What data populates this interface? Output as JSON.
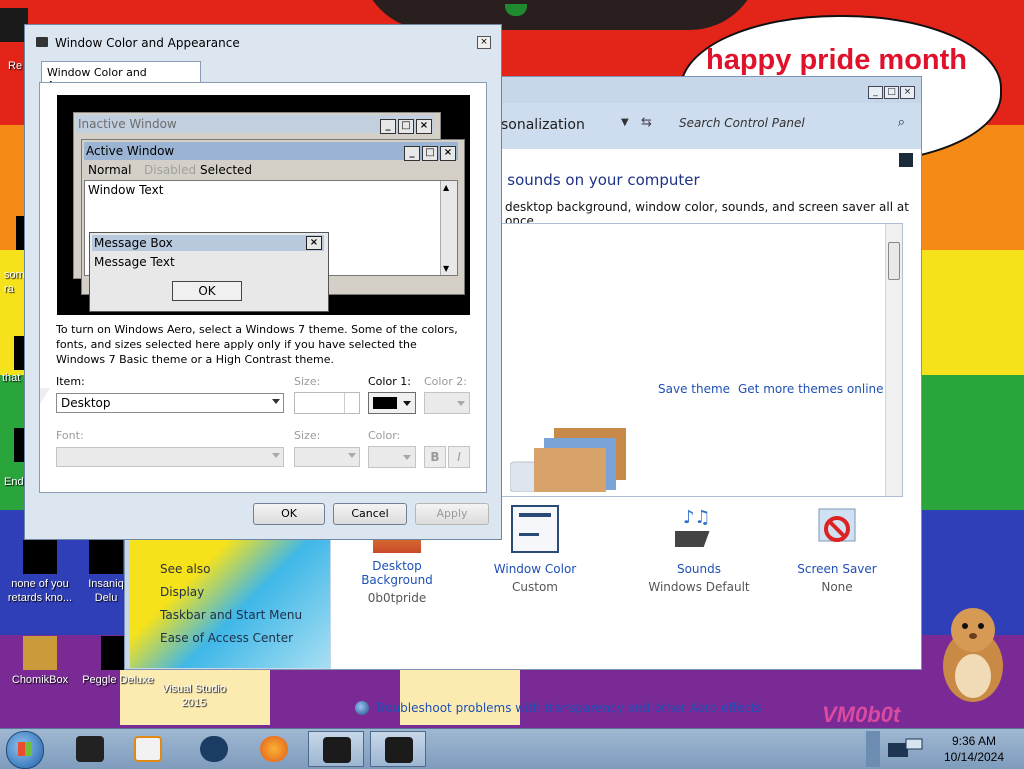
{
  "desktop": {
    "speech_text": "happy pride month",
    "watermark": "VM0b0t",
    "icons": [
      {
        "label": "none of you retards kno..."
      },
      {
        "label": "Insaniq Delu"
      },
      {
        "label": "ChomikBox"
      },
      {
        "label": "Peggle Deluxe"
      },
      {
        "label": "Visual Studio 2015"
      }
    ],
    "partial_labels": [
      "Re",
      "som ra",
      "that",
      "End"
    ]
  },
  "taskbar": {
    "time": "9:36 AM",
    "date": "10/14/2024"
  },
  "personalization": {
    "breadcrumb": "sonalization",
    "search_placeholder": "Search Control Panel",
    "heading": "d sounds on your computer",
    "subtitle": "desktop background, window color, sounds, and screen saver all at once.",
    "save_theme": "Save theme",
    "more_themes": "Get more themes online",
    "see_also": "See also",
    "links": [
      "Display",
      "Taskbar and Start Menu",
      "Ease of Access Center"
    ],
    "items": [
      {
        "label": "Desktop Background",
        "value": "0b0tpride"
      },
      {
        "label": "Window Color",
        "value": "Custom"
      },
      {
        "label": "Sounds",
        "value": "Windows Default"
      },
      {
        "label": "Screen Saver",
        "value": "None"
      }
    ],
    "troubleshoot": "Troubleshoot problems with transparency and other Aero effects"
  },
  "dialog": {
    "title": "Window Color and Appearance",
    "tab_label": "Window Color and Appearance",
    "preview": {
      "inactive_title": "Inactive Window",
      "active_title": "Active Window",
      "menu_normal": "Normal",
      "menu_disabled": "Disabled",
      "menu_selected": "Selected",
      "window_text": "Window Text",
      "msgbox_title": "Message Box",
      "msgbox_text": "Message Text",
      "msgbox_ok": "OK"
    },
    "aero_note": "To turn on Windows Aero, select a Windows 7 theme.  Some of the colors, fonts, and sizes selected here apply only if you have selected the Windows 7 Basic theme or a High Contrast theme.",
    "item_label": "Item:",
    "item_value": "Desktop",
    "size_label": "Size:",
    "color1_label": "Color 1:",
    "color2_label": "Color 2:",
    "font_label": "Font:",
    "font_size_label": "Size:",
    "font_color_label": "Color:",
    "bold_label": "B",
    "italic_label": "I",
    "color1_value": "#000000",
    "buttons": {
      "ok": "OK",
      "cancel": "Cancel",
      "apply": "Apply"
    }
  }
}
